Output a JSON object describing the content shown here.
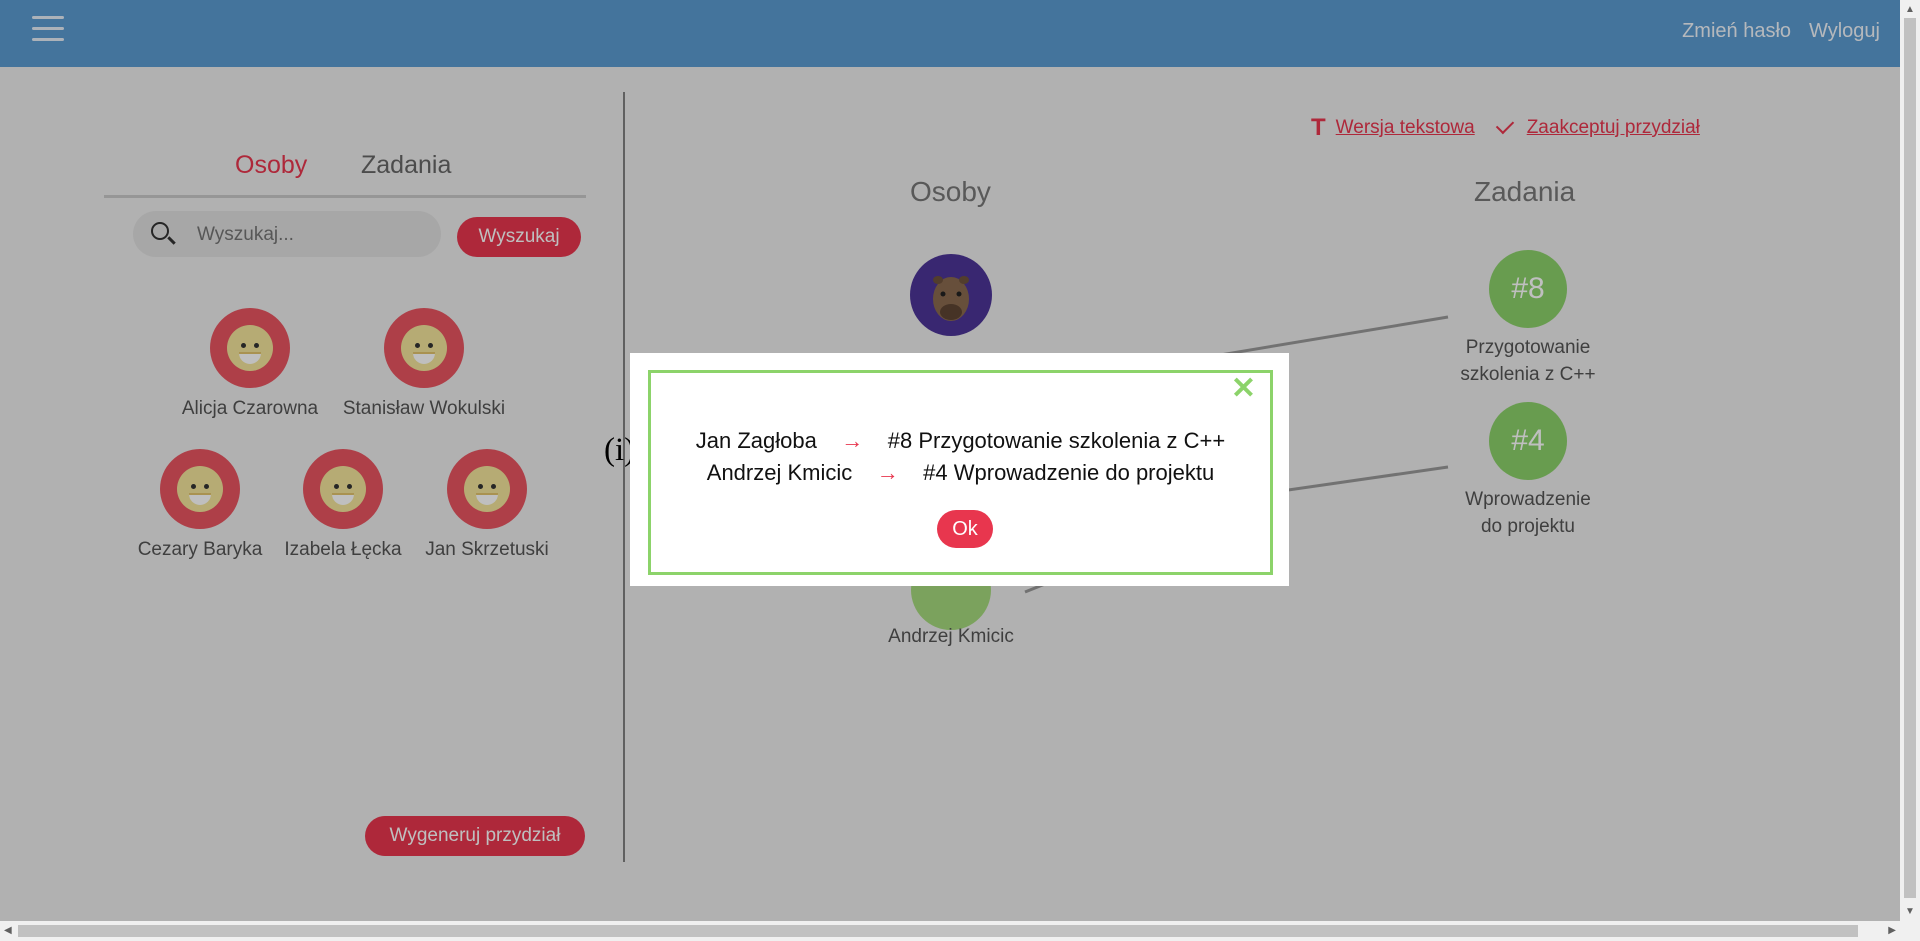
{
  "header": {
    "change_password": "Zmień hasło",
    "logout": "Wyloguj"
  },
  "sidebar": {
    "tabs": [
      "Osoby",
      "Zadania"
    ],
    "search_placeholder": "Wyszukaj...",
    "search_button": "Wyszukaj",
    "people": [
      "Alicja Czarowna",
      "Stanisław Wokulski",
      "Cezary Baryka",
      "Izabela Łęcka",
      "Jan Skrzetuski"
    ],
    "generate_button": "Wygeneruj przydział"
  },
  "main": {
    "text_version_link": "Wersja tekstowa",
    "accept_link": "Zaakceptuj przydział",
    "people_heading": "Osoby",
    "tasks_heading": "Zadania",
    "visible_person": "Andrzej Kmicic",
    "tasks": [
      {
        "number": "#8",
        "label_line1": "Przygotowanie",
        "label_line2": "szkolenia z C++"
      },
      {
        "number": "#4",
        "label_line1": "Wprowadzenie",
        "label_line2": "do projektu"
      }
    ]
  },
  "modal": {
    "info_mark": "(i)",
    "close_icon": "close-icon",
    "assignments": [
      {
        "person": "Jan Zagłoba",
        "arrow": "→",
        "task": "#8 Przygotowanie szkolenia z C++"
      },
      {
        "person": "Andrzej Kmicic",
        "arrow": "→",
        "task": "#4 Wprowadzenie do projektu"
      }
    ],
    "ok_button": "Ok"
  },
  "colors": {
    "accent_red": "#e8364e",
    "header_blue": "#5b9bd1",
    "task_green": "#8bd06a"
  }
}
